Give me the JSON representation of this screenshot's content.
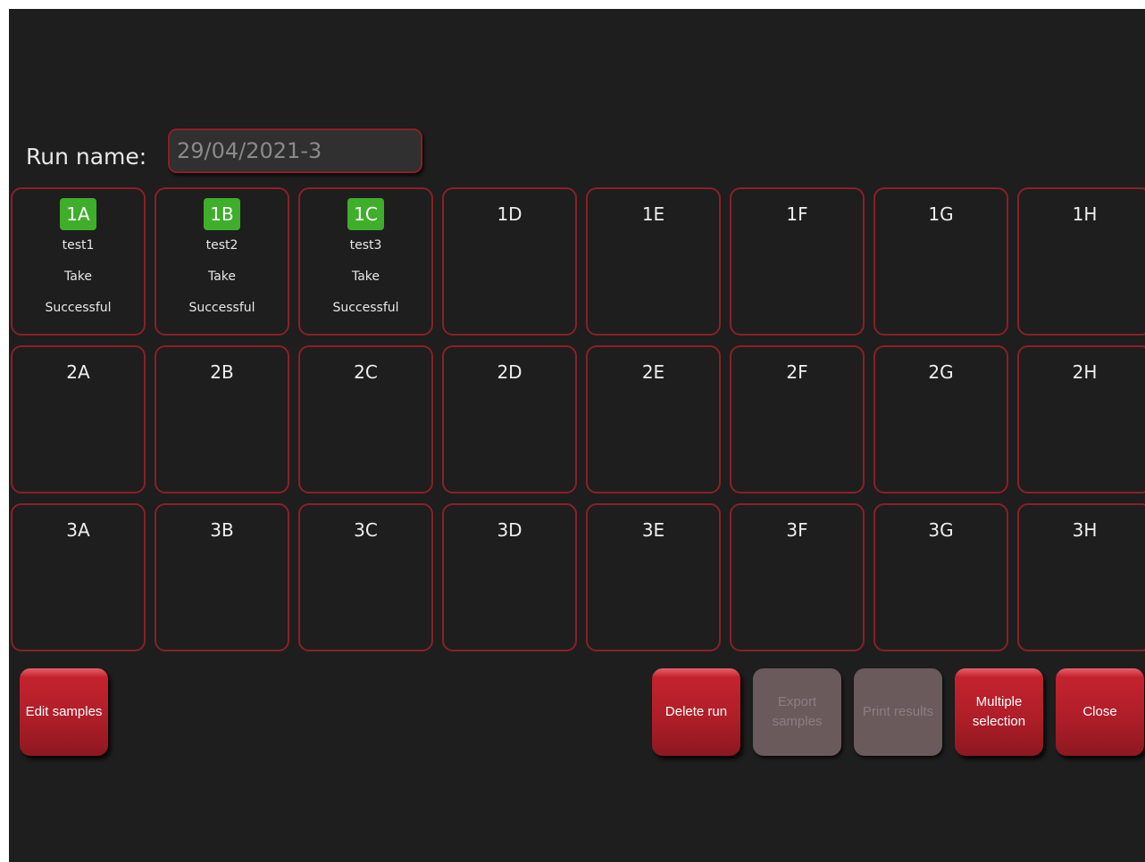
{
  "run": {
    "label": "Run name:",
    "value": "29/04/2021-3"
  },
  "wells": [
    {
      "id": "1A",
      "lines": [
        "test1",
        "Take",
        "Successful"
      ],
      "filled": true
    },
    {
      "id": "1B",
      "lines": [
        "test2",
        "Take",
        "Successful"
      ],
      "filled": true
    },
    {
      "id": "1C",
      "lines": [
        "test3",
        "Take",
        "Successful"
      ],
      "filled": true
    },
    {
      "id": "1D",
      "lines": [],
      "filled": false
    },
    {
      "id": "1E",
      "lines": [],
      "filled": false
    },
    {
      "id": "1F",
      "lines": [],
      "filled": false
    },
    {
      "id": "1G",
      "lines": [],
      "filled": false
    },
    {
      "id": "1H",
      "lines": [],
      "filled": false
    },
    {
      "id": "2A",
      "lines": [],
      "filled": false
    },
    {
      "id": "2B",
      "lines": [],
      "filled": false
    },
    {
      "id": "2C",
      "lines": [],
      "filled": false
    },
    {
      "id": "2D",
      "lines": [],
      "filled": false
    },
    {
      "id": "2E",
      "lines": [],
      "filled": false
    },
    {
      "id": "2F",
      "lines": [],
      "filled": false
    },
    {
      "id": "2G",
      "lines": [],
      "filled": false
    },
    {
      "id": "2H",
      "lines": [],
      "filled": false
    },
    {
      "id": "3A",
      "lines": [],
      "filled": false
    },
    {
      "id": "3B",
      "lines": [],
      "filled": false
    },
    {
      "id": "3C",
      "lines": [],
      "filled": false
    },
    {
      "id": "3D",
      "lines": [],
      "filled": false
    },
    {
      "id": "3E",
      "lines": [],
      "filled": false
    },
    {
      "id": "3F",
      "lines": [],
      "filled": false
    },
    {
      "id": "3G",
      "lines": [],
      "filled": false
    },
    {
      "id": "3H",
      "lines": [],
      "filled": false
    }
  ],
  "buttons": {
    "edit_samples": "Edit samples",
    "delete_run": "Delete run",
    "export_samples": "Export samples",
    "print_results": "Print results",
    "multiple_selection": "Multiple selection",
    "close": "Close"
  },
  "colors": {
    "background": "#1e1e1e",
    "well_border": "#8a2027",
    "well_ok": "#3fae2a",
    "button": "#b01e28",
    "button_disabled": "#6a5a5c"
  }
}
